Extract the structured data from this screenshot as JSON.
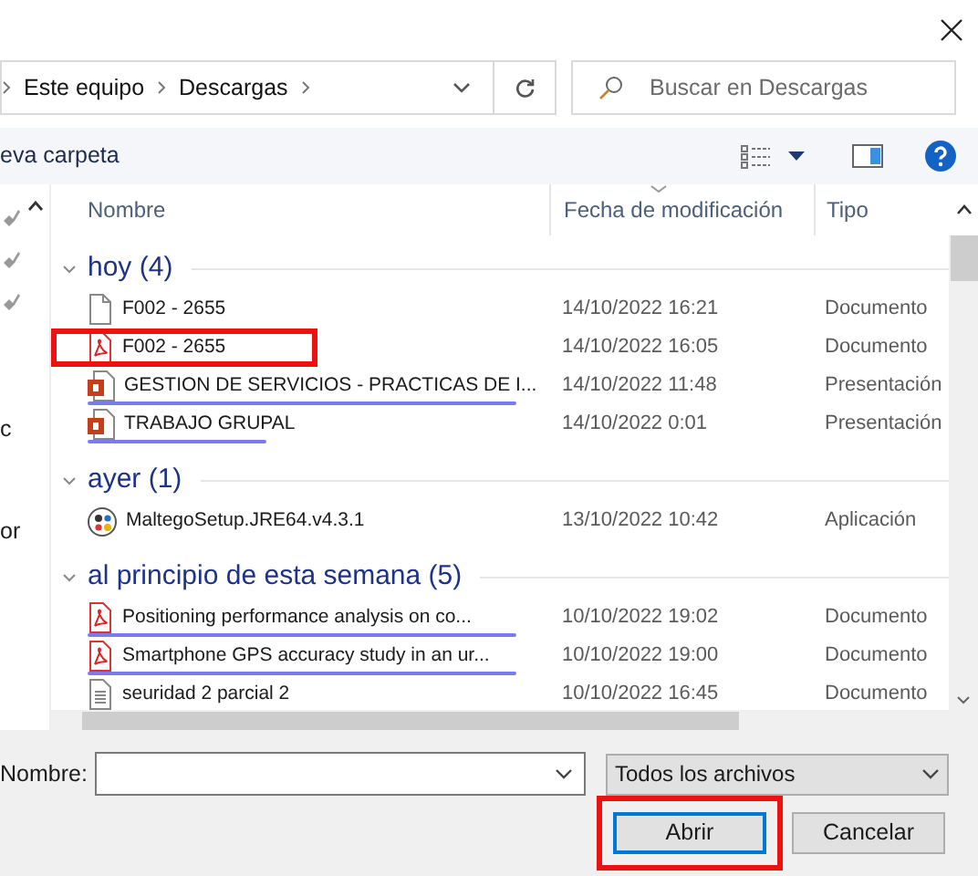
{
  "address": {
    "crumbs": [
      "Este equipo",
      "Descargas"
    ]
  },
  "search": {
    "placeholder": "Buscar en Descargas"
  },
  "toolbar": {
    "new_folder": "eva carpeta"
  },
  "nav_pane": {
    "items": [
      "c",
      "or"
    ]
  },
  "columns": [
    "Nombre",
    "Fecha de modificación",
    "Tipo"
  ],
  "groups": [
    {
      "title": "hoy (4)",
      "expanded": true,
      "files": [
        {
          "name": "F002 - 2655",
          "date": "14/10/2022 16:21",
          "type": "Documento",
          "kind": "blank",
          "highlighted": false,
          "scribbled": false
        },
        {
          "name": "F002 - 2655",
          "date": "14/10/2022 16:05",
          "type": "Documento",
          "kind": "pdf",
          "highlighted": true,
          "scribbled": false
        },
        {
          "name": "GESTION DE SERVICIOS - PRACTICAS DE I...",
          "date": "14/10/2022 11:48",
          "type": "Presentación",
          "kind": "slides",
          "highlighted": false,
          "scribbled": true
        },
        {
          "name": "TRABAJO GRUPAL",
          "date": "14/10/2022 0:01",
          "type": "Presentación",
          "kind": "slides",
          "highlighted": false,
          "scribbled": true
        }
      ]
    },
    {
      "title": "ayer (1)",
      "expanded": true,
      "files": [
        {
          "name": "MaltegoSetup.JRE64.v4.3.1",
          "date": "13/10/2022 10:42",
          "type": "Aplicación",
          "kind": "app",
          "highlighted": false,
          "scribbled": false
        }
      ]
    },
    {
      "title": "al principio de esta semana (5)",
      "expanded": true,
      "files": [
        {
          "name": "Positioning performance analysis on co...",
          "date": "10/10/2022 19:02",
          "type": "Documento",
          "kind": "pdf",
          "highlighted": false,
          "scribbled": true
        },
        {
          "name": "Smartphone GPS accuracy study in an ur...",
          "date": "10/10/2022 19:00",
          "type": "Documento",
          "kind": "pdf",
          "highlighted": false,
          "scribbled": true
        },
        {
          "name": "seuridad 2 parcial 2",
          "date": "10/10/2022 16:45",
          "type": "Documento",
          "kind": "text",
          "highlighted": false,
          "scribbled": false
        }
      ]
    }
  ],
  "file_name": {
    "label": "Nombre:"
  },
  "file_type": "Todos los archivos",
  "buttons": [
    {
      "label": "Abrir",
      "default": true,
      "highlighted": true
    },
    {
      "label": "Cancelar",
      "default": false,
      "highlighted": false
    }
  ]
}
